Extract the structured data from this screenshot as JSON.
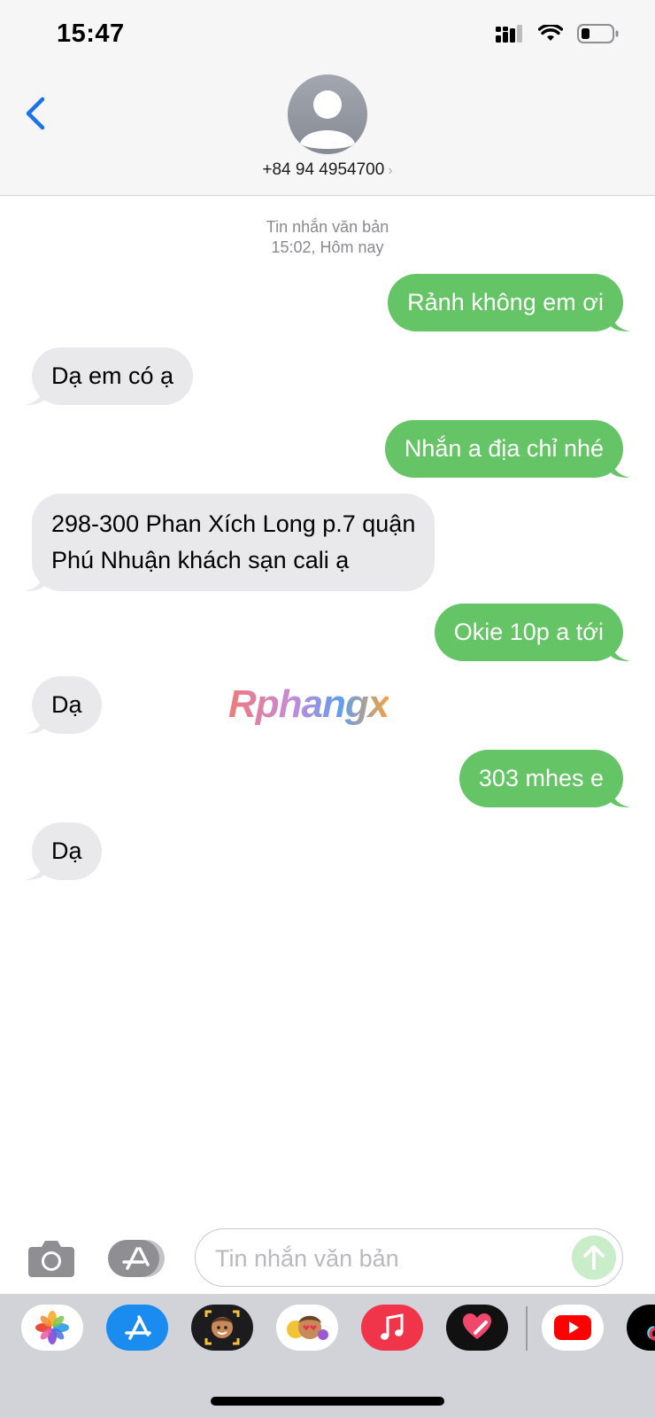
{
  "status_bar": {
    "time": "15:47"
  },
  "header": {
    "contact": "+84 94 4954700"
  },
  "thread": {
    "service": "Tin nhắn văn bản",
    "timestamp": "15:02, Hôm nay",
    "messages": [
      {
        "from": "me",
        "text": "Rảnh không em ơi"
      },
      {
        "from": "them",
        "text": "Dạ em có ạ"
      },
      {
        "from": "me",
        "text": "Nhắn a địa chỉ nhé"
      },
      {
        "from": "them",
        "line1": "298-300 Phan Xích Long p.7 quận",
        "line2": "Phú Nhuận khách sạn cali ạ"
      },
      {
        "from": "me",
        "text": "Okie 10p a tới"
      },
      {
        "from": "them",
        "text": "Dạ"
      },
      {
        "from": "me",
        "text": "303 mhes e"
      },
      {
        "from": "them",
        "text": "Dạ"
      }
    ]
  },
  "watermark": "Rphangx",
  "composer": {
    "placeholder": "Tin nhắn văn bản"
  },
  "app_drawer": [
    "photos-icon",
    "app-store-icon",
    "memoji-icon",
    "animoji-stickers-icon",
    "music-icon",
    "digital-touch-icon",
    "youtube-icon",
    "tiktok-icon"
  ],
  "colors": {
    "sent_bubble": "#65c466",
    "received_bubble": "#e9e9eb",
    "accent": "#1a73e8"
  }
}
